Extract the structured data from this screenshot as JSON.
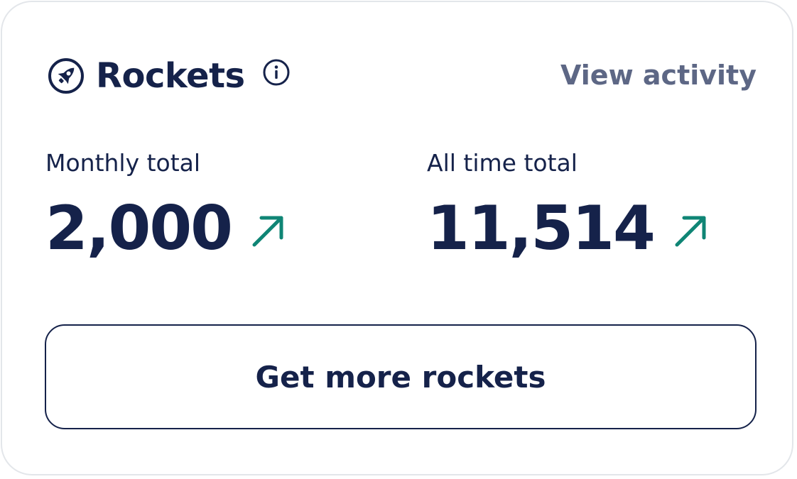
{
  "card": {
    "icon": "rocket-icon",
    "title": "Rockets",
    "info_icon": "info-icon",
    "view_activity_label": "View activity"
  },
  "stats": {
    "monthly": {
      "label": "Monthly total",
      "value": "2,000",
      "trend_icon": "trend-up-arrow-icon"
    },
    "all_time": {
      "label": "All time total",
      "value": "11,514",
      "trend_icon": "trend-up-arrow-icon"
    }
  },
  "cta": {
    "label": "Get more rockets"
  },
  "colors": {
    "primary_text": "#15224a",
    "muted_link": "#5d6785",
    "trend_accent": "#0f8575",
    "card_border": "#e3e6ea"
  }
}
